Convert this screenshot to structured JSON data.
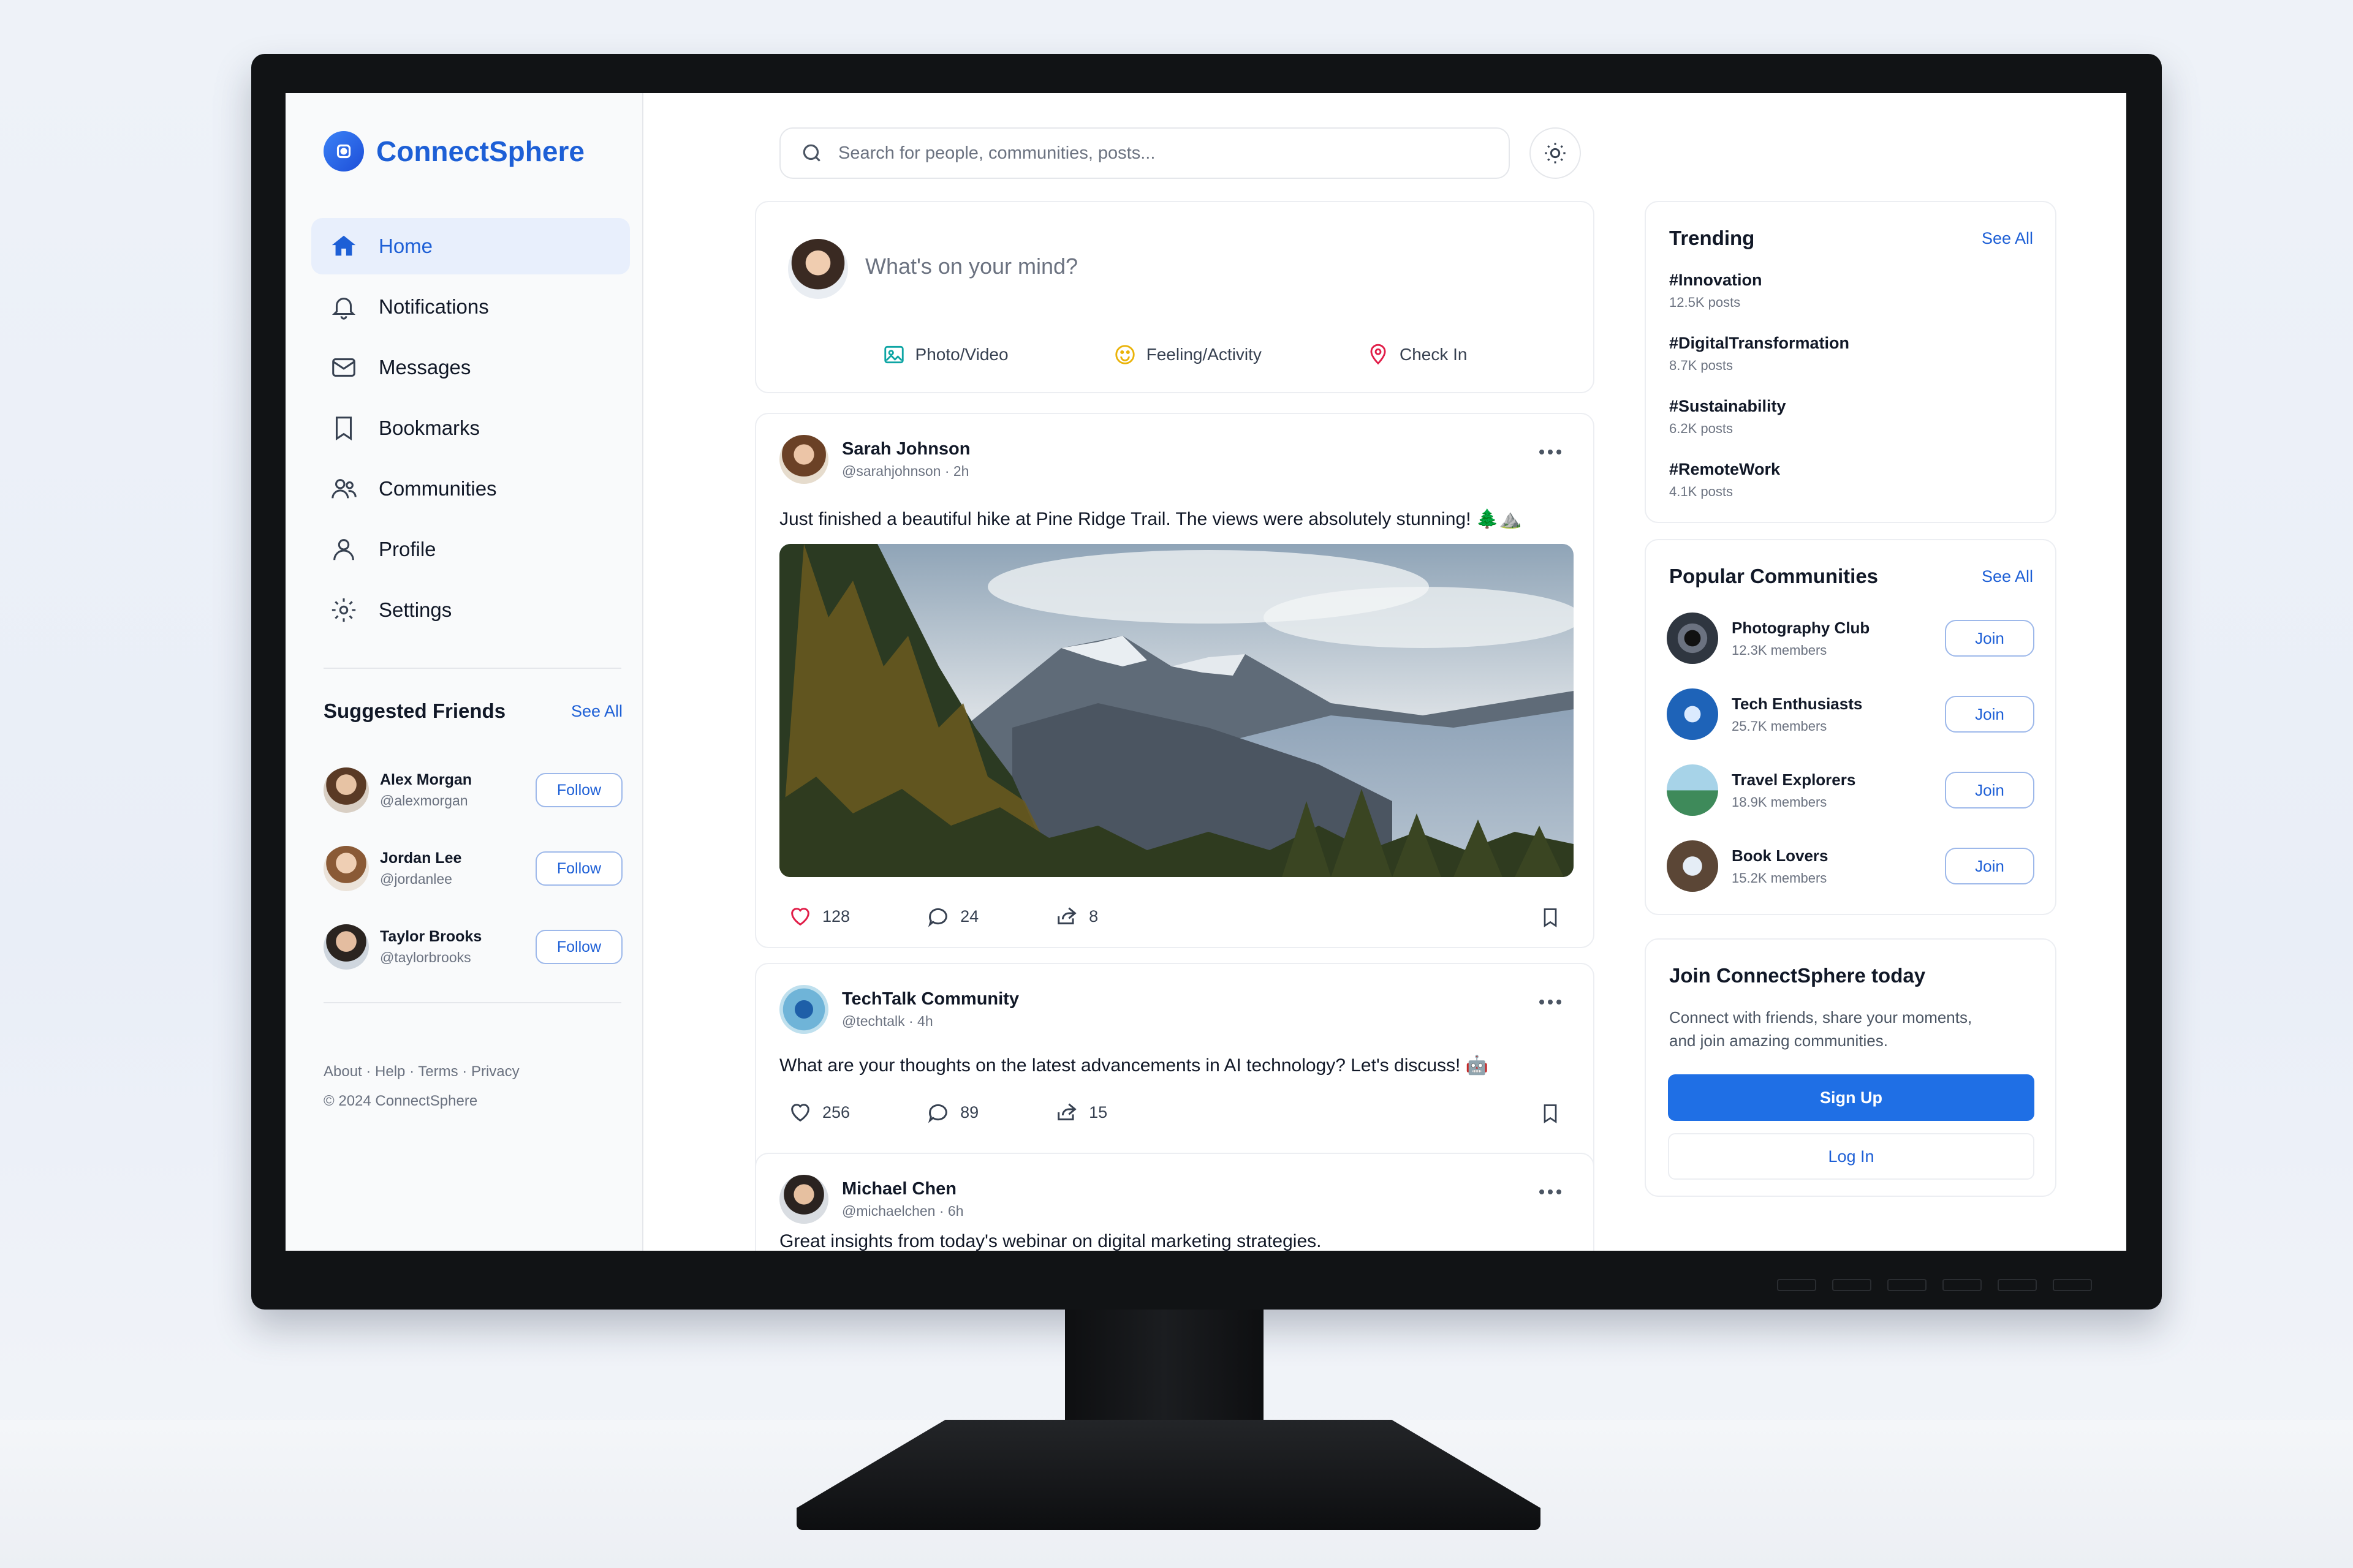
{
  "app": {
    "name": "ConnectSphere"
  },
  "nav": [
    {
      "label": "Home",
      "icon": "home-icon",
      "active": true
    },
    {
      "label": "Notifications",
      "icon": "bell-icon"
    },
    {
      "label": "Messages",
      "icon": "mail-icon"
    },
    {
      "label": "Bookmarks",
      "icon": "bookmark-icon"
    },
    {
      "label": "Communities",
      "icon": "users-icon"
    },
    {
      "label": "Profile",
      "icon": "user-icon"
    },
    {
      "label": "Settings",
      "icon": "gear-icon"
    }
  ],
  "suggested": {
    "title": "Suggested Friends",
    "see_all": "See All",
    "friends": [
      {
        "name": "Alex Morgan",
        "handle": "@alexmorgan",
        "action": "Follow"
      },
      {
        "name": "Jordan Lee",
        "handle": "@jordanlee",
        "action": "Follow"
      },
      {
        "name": "Taylor Brooks",
        "handle": "@taylorbrooks",
        "action": "Follow"
      }
    ]
  },
  "footer": {
    "links": "About · Help · Terms · Privacy",
    "copyright": "© 2024 ConnectSphere"
  },
  "search": {
    "placeholder": "Search for people, communities, posts..."
  },
  "composer": {
    "placeholder": "What's on your mind?",
    "actions": {
      "photo": "Photo/Video",
      "feeling": "Feeling/Activity",
      "checkin": "Check In"
    }
  },
  "posts": [
    {
      "author": "Sarah Johnson",
      "handle": "@sarahjohnson · 2h",
      "text": "Just finished a beautiful hike at Pine Ridge Trail. The views were absolutely stunning! 🌲⛰️",
      "likes": "128",
      "comments": "24",
      "shares": "8"
    },
    {
      "author": "TechTalk Community",
      "handle": "@techtalk · 4h",
      "text": "What are your thoughts on the latest advancements in AI technology? Let's discuss! 🤖",
      "likes": "256",
      "comments": "89",
      "shares": "15"
    },
    {
      "author": "Michael Chen",
      "handle": "@michaelchen · 6h",
      "text": "Great insights from today's webinar on digital marketing strategies."
    }
  ],
  "trending": {
    "title": "Trending",
    "see_all": "See All",
    "items": [
      {
        "tag": "#Innovation",
        "count": "12.5K posts"
      },
      {
        "tag": "#DigitalTransformation",
        "count": "8.7K posts"
      },
      {
        "tag": "#Sustainability",
        "count": "6.2K posts"
      },
      {
        "tag": "#RemoteWork",
        "count": "4.1K posts"
      }
    ]
  },
  "communities": {
    "title": "Popular Communities",
    "see_all": "See All",
    "items": [
      {
        "name": "Photography Club",
        "members": "12.3K members",
        "action": "Join"
      },
      {
        "name": "Tech Enthusiasts",
        "members": "25.7K members",
        "action": "Join"
      },
      {
        "name": "Travel Explorers",
        "members": "18.9K members",
        "action": "Join"
      },
      {
        "name": "Book Lovers",
        "members": "15.2K members",
        "action": "Join"
      }
    ]
  },
  "join": {
    "title": "Join ConnectSphere today",
    "description_line1": "Connect with friends, share your moments,",
    "description_line2": "and join amazing communities.",
    "signup": "Sign Up",
    "login": "Log In"
  },
  "colors": {
    "accent": "#1d5fd6",
    "button": "#1f6fe5",
    "like": "#e11d48"
  }
}
